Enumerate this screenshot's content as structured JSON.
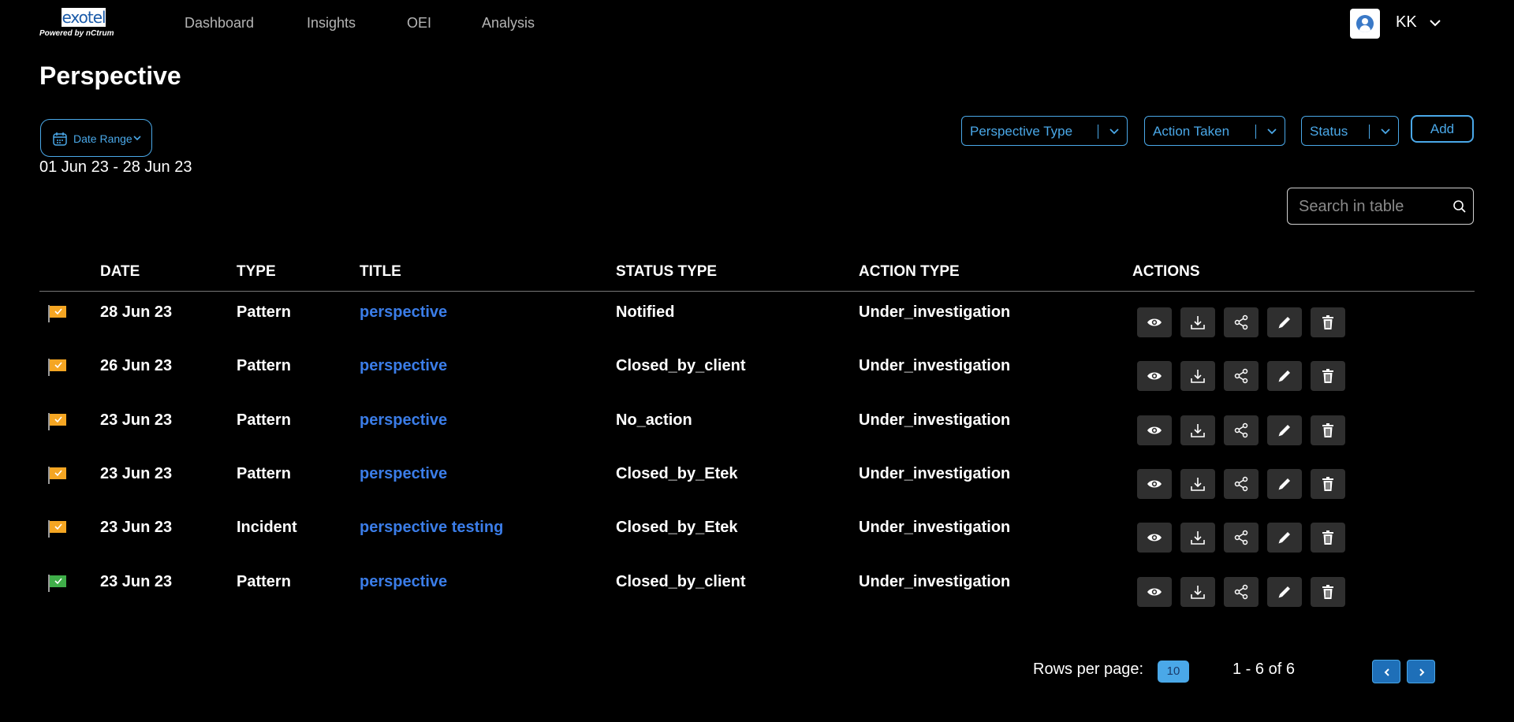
{
  "brand": {
    "logo_text": "exotel",
    "powered_by": "Powered by  nCtrum"
  },
  "nav": {
    "items": [
      "Dashboard",
      "Insights",
      "OEI",
      "Analysis"
    ]
  },
  "user": {
    "initials": "KK"
  },
  "page": {
    "title": "Perspective"
  },
  "date_filter": {
    "label": "Date Range",
    "range": "01 Jun 23 - 28 Jun 23"
  },
  "filters": {
    "perspective_type": "Perspective Type",
    "action_taken": "Action Taken",
    "status": "Status"
  },
  "add_label": "Add",
  "search": {
    "placeholder": "Search in table"
  },
  "table": {
    "headers": [
      "Date",
      "Type",
      "Title",
      "Status Type",
      "Action Type",
      "Actions"
    ],
    "rows": [
      {
        "flag_color": "#f5a623",
        "date": "28 Jun 23",
        "type": "Pattern",
        "title": "perspective",
        "status": "Notified",
        "action": "Under_investigation"
      },
      {
        "flag_color": "#f5a623",
        "date": "26 Jun 23",
        "type": "Pattern",
        "title": "perspective",
        "status": "Closed_by_client",
        "action": "Under_investigation"
      },
      {
        "flag_color": "#f5a623",
        "date": "23 Jun 23",
        "type": "Pattern",
        "title": "perspective",
        "status": "No_action",
        "action": "Under_investigation"
      },
      {
        "flag_color": "#f5a623",
        "date": "23 Jun 23",
        "type": "Pattern",
        "title": "perspective",
        "status": "Closed_by_Etek",
        "action": "Under_investigation"
      },
      {
        "flag_color": "#f5a623",
        "date": "23 Jun 23",
        "type": "Incident",
        "title": "perspective testing",
        "status": "Closed_by_Etek",
        "action": "Under_investigation"
      },
      {
        "flag_color": "#3fae49",
        "date": "23 Jun 23",
        "type": "Pattern",
        "title": "perspective",
        "status": "Closed_by_client",
        "action": "Under_investigation"
      }
    ]
  },
  "pagination": {
    "rows_per_page_label": "Rows per page:",
    "rows_per_page": "10",
    "range": "1 - 6 of 6"
  },
  "colors": {
    "accent": "#4aa8e8",
    "link": "#3b7de8",
    "flag_pending": "#f5a623",
    "flag_done": "#3fae49"
  }
}
